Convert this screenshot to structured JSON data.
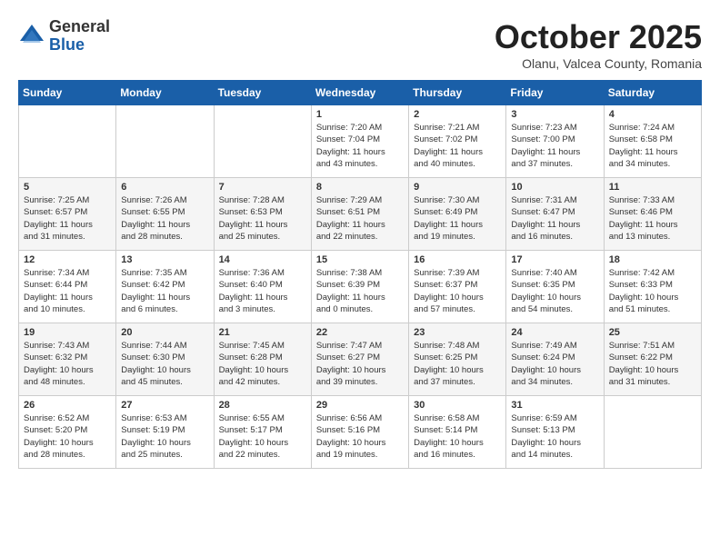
{
  "header": {
    "logo": {
      "general": "General",
      "blue": "Blue"
    },
    "title": "October 2025",
    "subtitle": "Olanu, Valcea County, Romania"
  },
  "weekdays": [
    "Sunday",
    "Monday",
    "Tuesday",
    "Wednesday",
    "Thursday",
    "Friday",
    "Saturday"
  ],
  "weeks": [
    [
      {
        "day": "",
        "info": ""
      },
      {
        "day": "",
        "info": ""
      },
      {
        "day": "",
        "info": ""
      },
      {
        "day": "1",
        "info": "Sunrise: 7:20 AM\nSunset: 7:04 PM\nDaylight: 11 hours\nand 43 minutes."
      },
      {
        "day": "2",
        "info": "Sunrise: 7:21 AM\nSunset: 7:02 PM\nDaylight: 11 hours\nand 40 minutes."
      },
      {
        "day": "3",
        "info": "Sunrise: 7:23 AM\nSunset: 7:00 PM\nDaylight: 11 hours\nand 37 minutes."
      },
      {
        "day": "4",
        "info": "Sunrise: 7:24 AM\nSunset: 6:58 PM\nDaylight: 11 hours\nand 34 minutes."
      }
    ],
    [
      {
        "day": "5",
        "info": "Sunrise: 7:25 AM\nSunset: 6:57 PM\nDaylight: 11 hours\nand 31 minutes."
      },
      {
        "day": "6",
        "info": "Sunrise: 7:26 AM\nSunset: 6:55 PM\nDaylight: 11 hours\nand 28 minutes."
      },
      {
        "day": "7",
        "info": "Sunrise: 7:28 AM\nSunset: 6:53 PM\nDaylight: 11 hours\nand 25 minutes."
      },
      {
        "day": "8",
        "info": "Sunrise: 7:29 AM\nSunset: 6:51 PM\nDaylight: 11 hours\nand 22 minutes."
      },
      {
        "day": "9",
        "info": "Sunrise: 7:30 AM\nSunset: 6:49 PM\nDaylight: 11 hours\nand 19 minutes."
      },
      {
        "day": "10",
        "info": "Sunrise: 7:31 AM\nSunset: 6:47 PM\nDaylight: 11 hours\nand 16 minutes."
      },
      {
        "day": "11",
        "info": "Sunrise: 7:33 AM\nSunset: 6:46 PM\nDaylight: 11 hours\nand 13 minutes."
      }
    ],
    [
      {
        "day": "12",
        "info": "Sunrise: 7:34 AM\nSunset: 6:44 PM\nDaylight: 11 hours\nand 10 minutes."
      },
      {
        "day": "13",
        "info": "Sunrise: 7:35 AM\nSunset: 6:42 PM\nDaylight: 11 hours\nand 6 minutes."
      },
      {
        "day": "14",
        "info": "Sunrise: 7:36 AM\nSunset: 6:40 PM\nDaylight: 11 hours\nand 3 minutes."
      },
      {
        "day": "15",
        "info": "Sunrise: 7:38 AM\nSunset: 6:39 PM\nDaylight: 11 hours\nand 0 minutes."
      },
      {
        "day": "16",
        "info": "Sunrise: 7:39 AM\nSunset: 6:37 PM\nDaylight: 10 hours\nand 57 minutes."
      },
      {
        "day": "17",
        "info": "Sunrise: 7:40 AM\nSunset: 6:35 PM\nDaylight: 10 hours\nand 54 minutes."
      },
      {
        "day": "18",
        "info": "Sunrise: 7:42 AM\nSunset: 6:33 PM\nDaylight: 10 hours\nand 51 minutes."
      }
    ],
    [
      {
        "day": "19",
        "info": "Sunrise: 7:43 AM\nSunset: 6:32 PM\nDaylight: 10 hours\nand 48 minutes."
      },
      {
        "day": "20",
        "info": "Sunrise: 7:44 AM\nSunset: 6:30 PM\nDaylight: 10 hours\nand 45 minutes."
      },
      {
        "day": "21",
        "info": "Sunrise: 7:45 AM\nSunset: 6:28 PM\nDaylight: 10 hours\nand 42 minutes."
      },
      {
        "day": "22",
        "info": "Sunrise: 7:47 AM\nSunset: 6:27 PM\nDaylight: 10 hours\nand 39 minutes."
      },
      {
        "day": "23",
        "info": "Sunrise: 7:48 AM\nSunset: 6:25 PM\nDaylight: 10 hours\nand 37 minutes."
      },
      {
        "day": "24",
        "info": "Sunrise: 7:49 AM\nSunset: 6:24 PM\nDaylight: 10 hours\nand 34 minutes."
      },
      {
        "day": "25",
        "info": "Sunrise: 7:51 AM\nSunset: 6:22 PM\nDaylight: 10 hours\nand 31 minutes."
      }
    ],
    [
      {
        "day": "26",
        "info": "Sunrise: 6:52 AM\nSunset: 5:20 PM\nDaylight: 10 hours\nand 28 minutes."
      },
      {
        "day": "27",
        "info": "Sunrise: 6:53 AM\nSunset: 5:19 PM\nDaylight: 10 hours\nand 25 minutes."
      },
      {
        "day": "28",
        "info": "Sunrise: 6:55 AM\nSunset: 5:17 PM\nDaylight: 10 hours\nand 22 minutes."
      },
      {
        "day": "29",
        "info": "Sunrise: 6:56 AM\nSunset: 5:16 PM\nDaylight: 10 hours\nand 19 minutes."
      },
      {
        "day": "30",
        "info": "Sunrise: 6:58 AM\nSunset: 5:14 PM\nDaylight: 10 hours\nand 16 minutes."
      },
      {
        "day": "31",
        "info": "Sunrise: 6:59 AM\nSunset: 5:13 PM\nDaylight: 10 hours\nand 14 minutes."
      },
      {
        "day": "",
        "info": ""
      }
    ]
  ]
}
